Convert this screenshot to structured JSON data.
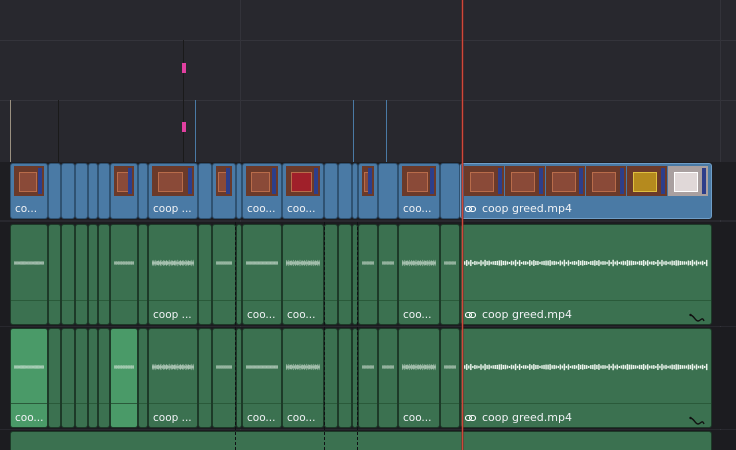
{
  "video_track": {
    "clips": [
      {
        "label": "co..."
      },
      {
        "label": "coop ..."
      },
      {
        "label": "coo..."
      },
      {
        "label": "coo..."
      },
      {
        "label": "coo..."
      },
      {
        "label": "coop greed.mp4"
      }
    ]
  },
  "audio_track_1": {
    "clips": [
      {
        "label": "coop ..."
      },
      {
        "label": "coo..."
      },
      {
        "label": "coo..."
      },
      {
        "label": "coo..."
      },
      {
        "label": "coop greed.mp4"
      }
    ]
  },
  "audio_track_2": {
    "clips": [
      {
        "label": "coo..."
      },
      {
        "label": "coop ..."
      },
      {
        "label": "coo..."
      },
      {
        "label": "coo..."
      },
      {
        "label": "coo..."
      },
      {
        "label": "coop greed.mp4"
      }
    ]
  },
  "icons": {
    "link": "link-icon",
    "curve": "fade-curve-icon"
  },
  "colors": {
    "video_clip": "#4a7aa5",
    "audio_clip": "#3b7150",
    "playhead": "#d0473a",
    "marker": "#e040a0"
  }
}
